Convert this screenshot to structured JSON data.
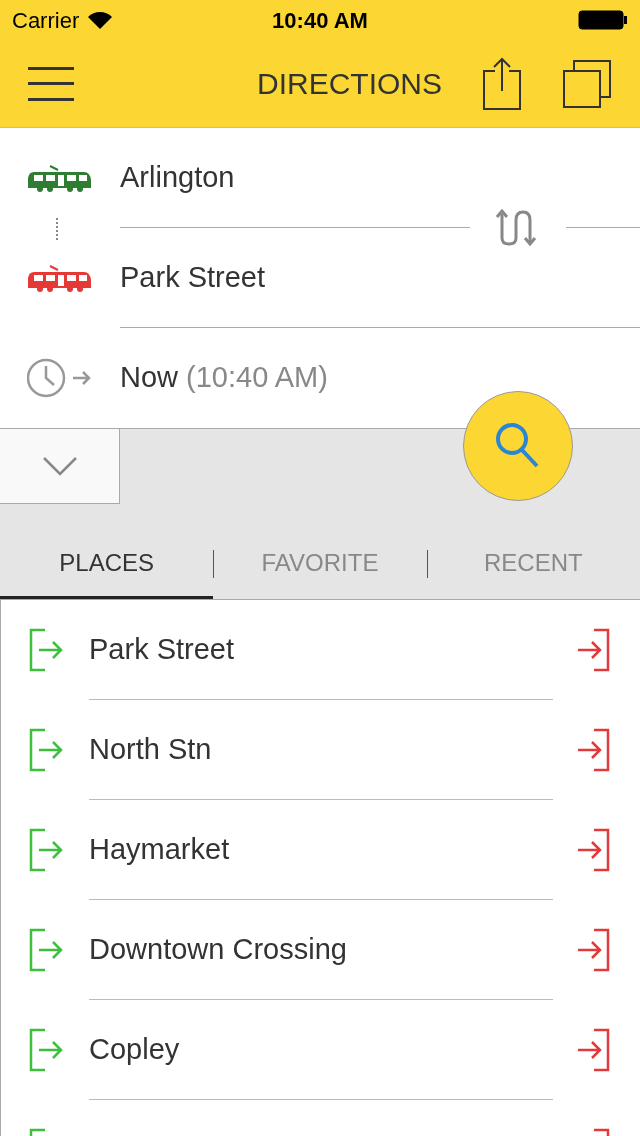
{
  "status_bar": {
    "carrier": "Carrier",
    "time": "10:40 AM"
  },
  "nav": {
    "title": "DIRECTIONS"
  },
  "route": {
    "from": "Arlington",
    "to": "Park Street",
    "time_label": "Now",
    "time_detail": "(10:40 AM)"
  },
  "tabs": [
    {
      "label": "PLACES",
      "selected": true
    },
    {
      "label": "FAVORITE",
      "selected": false
    },
    {
      "label": "RECENT",
      "selected": false
    }
  ],
  "places": [
    {
      "name": "Park Street"
    },
    {
      "name": "North Stn"
    },
    {
      "name": "Haymarket"
    },
    {
      "name": "Downtown Crossing"
    },
    {
      "name": "Copley"
    },
    {
      "kind": "partial"
    }
  ]
}
